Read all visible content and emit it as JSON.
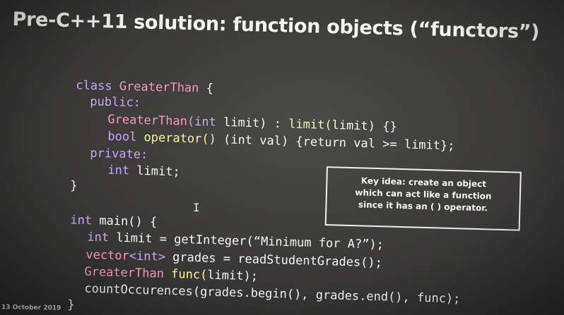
{
  "slide": {
    "title": "Pre-C++11 solution: function objects (“functors”)",
    "date": "13 October 2019",
    "key_idea": {
      "line1": "Key idea: create an object",
      "line2": "which can act like a function",
      "line3": "since it has an ( ) operator."
    },
    "cursor_glyph": "I"
  },
  "code": {
    "l1_kw": "class",
    "l1_name": "GreaterThan",
    "l1_rest": " {",
    "l2_kw": "public:",
    "l3_fn": "GreaterThan(",
    "l3_type": "int",
    "l3_param": " limit) : ",
    "l3_init": "limit(",
    "l3_arg": "limit) {}",
    "l4_type": "bool",
    "l4_op": " operator() ",
    "l4_rest": "(int val) {return val >= limit};",
    "l5_kw": "private:",
    "l6_type": "int",
    "l6_rest": " limit;",
    "l7": "}",
    "l8_type": "int",
    "l8_rest": " main() {",
    "l9_type": "int",
    "l9_rest": " limit = getInteger(",
    "l9_str": "“Minimum for A?”",
    "l9_end": ");",
    "l10_type": "vector",
    "l10_tparam": "<int>",
    "l10_rest": " grades = readStudentGrades();",
    "l11_type": "GreaterThan",
    "l11_fn": " func(",
    "l11_rest": "limit);",
    "l12": "countOccurences(grades.begin(), grades.end(), func);",
    "l13": "}"
  }
}
